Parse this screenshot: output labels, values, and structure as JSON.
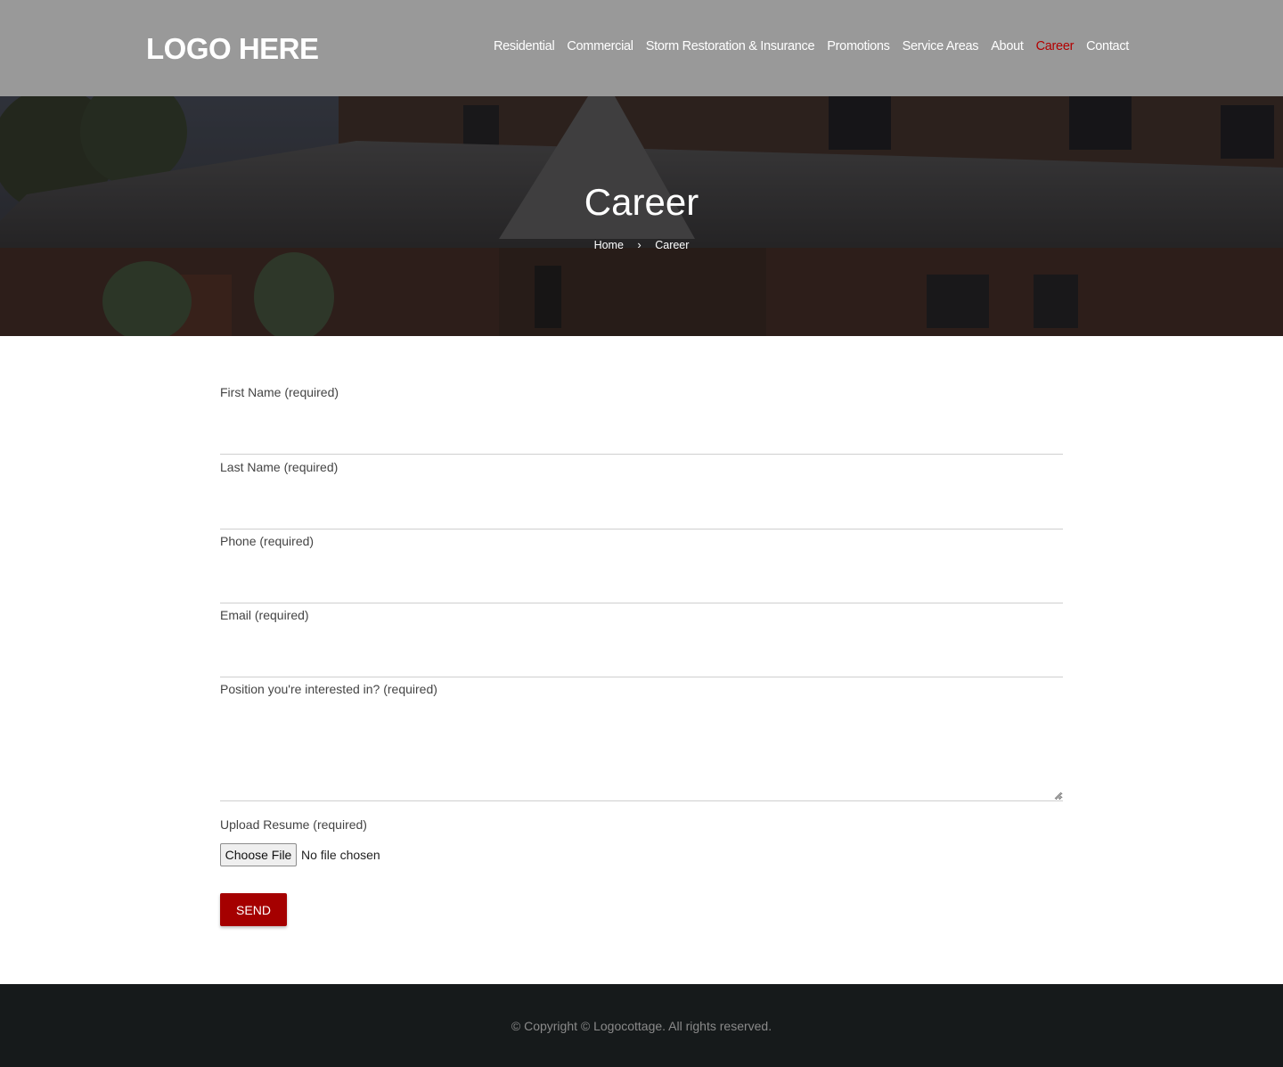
{
  "header": {
    "logo": "LOGO HERE",
    "nav": [
      {
        "label": "Residential",
        "active": false
      },
      {
        "label": "Commercial",
        "active": false
      },
      {
        "label": "Storm Restoration & Insurance",
        "active": false
      },
      {
        "label": "Promotions",
        "active": false
      },
      {
        "label": "Service Areas",
        "active": false
      },
      {
        "label": "About",
        "active": false
      },
      {
        "label": "Career",
        "active": true
      },
      {
        "label": "Contact",
        "active": false
      }
    ]
  },
  "hero": {
    "title": "Career",
    "breadcrumb": {
      "home": "Home",
      "separator": "›",
      "current": "Career"
    }
  },
  "form": {
    "first_name_label": "First Name (required)",
    "last_name_label": "Last Name (required)",
    "phone_label": "Phone (required)",
    "email_label": "Email (required)",
    "position_label": "Position you're interested in? (required)",
    "resume_label": "Upload Resume (required)",
    "choose_file": "Choose File",
    "no_file": "No file chosen",
    "send": "SEND"
  },
  "footer": {
    "copyright": "© Copyright © Logocottage. All rights reserved."
  },
  "colors": {
    "header_bg": "#999999",
    "accent": "#a50000",
    "footer_bg": "#161a1b"
  }
}
